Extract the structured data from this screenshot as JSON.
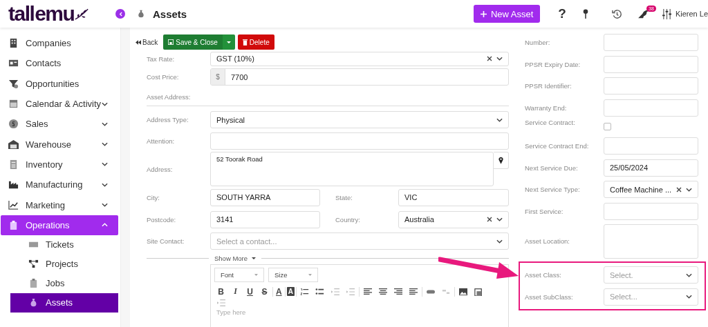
{
  "header": {
    "logo": "tall emu",
    "title": "Assets",
    "new_button": "New Asset",
    "help": "?",
    "notification_count": "38",
    "user": "Kieren Le"
  },
  "sidebar": {
    "items": [
      {
        "label": "Companies",
        "kind": "link",
        "selected": false
      },
      {
        "label": "Contacts",
        "kind": "link",
        "selected": false
      },
      {
        "label": "Opportunities",
        "kind": "link",
        "selected": false
      },
      {
        "label": "Calendar & Activity",
        "kind": "group",
        "expanded": false,
        "selected": false
      },
      {
        "label": "Sales",
        "kind": "group",
        "expanded": false,
        "selected": false
      },
      {
        "label": "Warehouse",
        "kind": "group",
        "expanded": false,
        "selected": false
      },
      {
        "label": "Inventory",
        "kind": "group",
        "expanded": false,
        "selected": false
      },
      {
        "label": "Manufacturing",
        "kind": "group",
        "expanded": false,
        "selected": false
      },
      {
        "label": "Marketing",
        "kind": "group",
        "expanded": false,
        "selected": false
      },
      {
        "label": "Operations",
        "kind": "group",
        "expanded": true,
        "selected": true,
        "children": [
          {
            "label": "Tickets",
            "selected": false
          },
          {
            "label": "Projects",
            "selected": false
          },
          {
            "label": "Jobs",
            "selected": false
          },
          {
            "label": "Assets",
            "selected": true
          }
        ]
      }
    ]
  },
  "actions": {
    "back": "Back",
    "save": "Save & Close",
    "delete": "Delete"
  },
  "left_form": {
    "rows": [
      {
        "kind": "field",
        "label": "Tax Rate:",
        "control": {
          "kind": "select",
          "value": "GST (10%)",
          "clearable": true
        }
      },
      {
        "kind": "field",
        "label": "Cost Price:",
        "control": {
          "kind": "money",
          "prefix": "$",
          "value": "7700"
        }
      },
      {
        "kind": "heading",
        "label": "Asset Address:"
      },
      {
        "kind": "field",
        "label": "Address Type:",
        "control": {
          "kind": "select",
          "value": "Physical",
          "clearable": false
        }
      },
      {
        "kind": "field",
        "label": "Attention:",
        "control": {
          "kind": "input"
        }
      },
      {
        "kind": "field",
        "label": "Address:",
        "control": {
          "kind": "textarea",
          "value": "52 Toorak Road",
          "pin": true
        }
      },
      {
        "kind": "pair",
        "fields": [
          {
            "label": "City:",
            "control": {
              "kind": "input",
              "value": "SOUTH YARRA"
            }
          },
          {
            "label": "State:",
            "control": {
              "kind": "input",
              "value": "VIC"
            }
          }
        ]
      },
      {
        "kind": "pair",
        "fields": [
          {
            "label": "Postcode:",
            "control": {
              "kind": "input",
              "value": "3141"
            }
          },
          {
            "label": "Country:",
            "control": {
              "kind": "select",
              "value": "Australia",
              "clearable": true
            }
          }
        ]
      },
      {
        "kind": "field",
        "label": "Site Contact:",
        "control": {
          "kind": "select",
          "placeholder": "Select a contact...",
          "clearable": false
        }
      }
    ]
  },
  "show_more": "Show More",
  "editor": {
    "font": "Font",
    "size": "Size",
    "format_buttons": [
      "B",
      "I",
      "U",
      "S"
    ],
    "text_color": "A",
    "highlight": "A",
    "placeholder": "Type here"
  },
  "right_form": {
    "rows": [
      {
        "label": "Number:",
        "control": {
          "kind": "input"
        }
      },
      {
        "label": "PPSR Expiry Date:",
        "control": {
          "kind": "input"
        }
      },
      {
        "label": "PPSR Identifier:",
        "control": {
          "kind": "input"
        }
      },
      {
        "label": "Warranty End:",
        "control": {
          "kind": "input"
        }
      },
      {
        "label": "Service Contract:",
        "control": {
          "kind": "checkbox",
          "checked": false
        }
      },
      {
        "label": "Service Contract End:",
        "control": {
          "kind": "input"
        }
      },
      {
        "label": "Next Service Due:",
        "control": {
          "kind": "input",
          "value": "25/05/2024"
        }
      },
      {
        "label": "Next Service Type:",
        "control": {
          "kind": "select",
          "value": "Coffee Machine ...",
          "clearable": true
        }
      },
      {
        "label": "First Service:",
        "control": {
          "kind": "input"
        }
      },
      {
        "label": "Asset Location:",
        "control": {
          "kind": "textarea"
        }
      }
    ],
    "highlighted_rows": [
      {
        "label": "Asset Class:",
        "control": {
          "kind": "select",
          "placeholder": "Select.",
          "clearable": false
        }
      },
      {
        "label": "Asset SubClass:",
        "control": {
          "kind": "select",
          "placeholder": "Select...",
          "clearable": false
        }
      }
    ]
  }
}
